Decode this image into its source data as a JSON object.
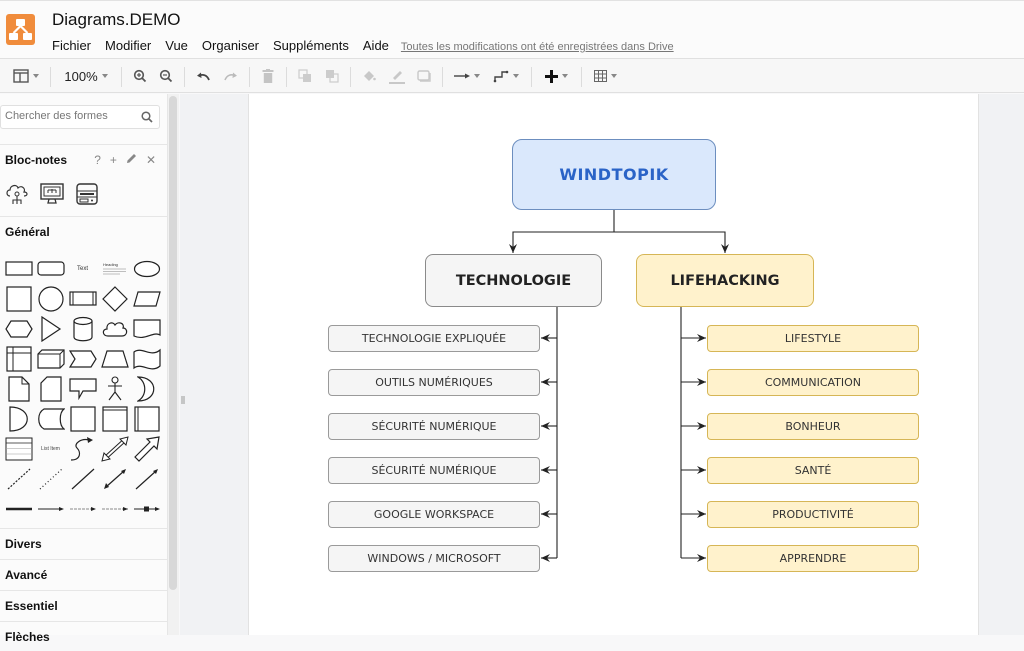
{
  "app": {
    "title": "Diagrams.DEMO",
    "logo_color": "#f08c3c"
  },
  "menu": {
    "items": [
      "Fichier",
      "Modifier",
      "Vue",
      "Organiser",
      "Suppléments",
      "Aide"
    ],
    "save_status": "Toutes les modifications ont été enregistrées dans Drive"
  },
  "toolbar": {
    "zoom_level": "100%",
    "buttons": [
      "format-panel",
      "zoom-in",
      "zoom-out",
      "undo",
      "redo",
      "delete",
      "to-front",
      "to-back",
      "fill-color",
      "line-color",
      "shadow",
      "connection-style",
      "waypoints",
      "insert",
      "table"
    ]
  },
  "sidebar": {
    "search_placeholder": "Chercher des formes",
    "scratchpad": {
      "title": "Bloc-notes",
      "help": "?",
      "add": "+",
      "edit_icon": "pencil-icon",
      "close": "✕",
      "items": [
        "cloud-network-icon",
        "monitor-network-icon",
        "server-rack-icon"
      ]
    },
    "general_title": "Général",
    "shape_text_label": "Text",
    "shape_heading_label": "Heading",
    "shape_list_label": "List Item",
    "sections": [
      "Divers",
      "Avancé",
      "Essentiel",
      "Flèches"
    ]
  },
  "diagram": {
    "root": {
      "label": "WINDTOPIK",
      "fill": "#dae8fc",
      "stroke": "#6c8ebf",
      "text_color": "#2a63c7"
    },
    "branches": [
      {
        "label": "TECHNOLOGIE",
        "fill": "#f5f5f5",
        "stroke": "#8a8a8a",
        "children": [
          "TECHNOLOGIE EXPLIQUÉE",
          "OUTILS NUMÉRIQUES",
          "SÉCURITÉ NUMÉRIQUE",
          "SÉCURITÉ NUMÉRIQUE",
          "GOOGLE WORKSPACE",
          "WINDOWS / MICROSOFT"
        ]
      },
      {
        "label": "LIFEHACKING",
        "fill": "#fff2cc",
        "stroke": "#d6b656",
        "children": [
          "LIFESTYLE",
          "COMMUNICATION",
          "BONHEUR",
          "SANTÉ",
          "PRODUCTIVITÉ",
          "APPRENDRE"
        ]
      }
    ]
  }
}
